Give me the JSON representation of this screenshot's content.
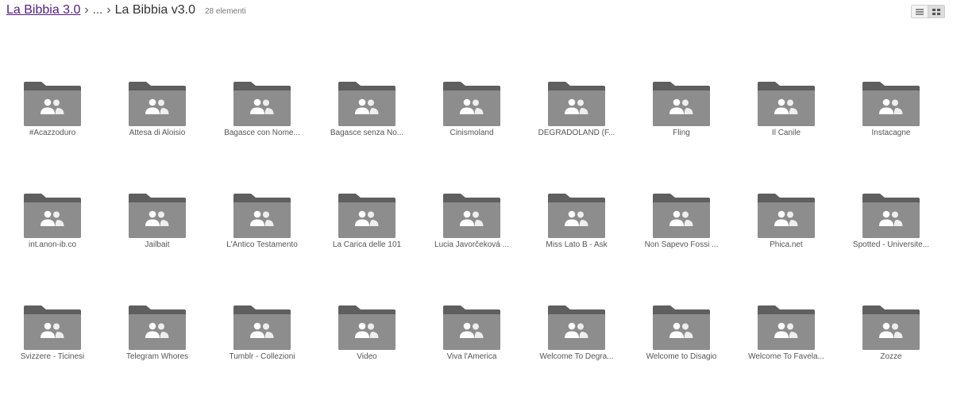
{
  "breadcrumb": {
    "root": "La Bibbia 3.0",
    "separator": "›",
    "ellipsis": "...",
    "current": "La Bibbia v3.0"
  },
  "item_count": "28 elementi",
  "view_toggle": {
    "list_icon": "list-view-icon",
    "grid_icon": "grid-view-icon",
    "active": "grid"
  },
  "colors": {
    "folder_body": "#8d8d8d",
    "folder_tab": "#5f5f5f",
    "folder_people": "#ffffff",
    "link": "#551a8b"
  },
  "folders": [
    {
      "name": "#Acazzoduro"
    },
    {
      "name": "Attesa di Aloisio"
    },
    {
      "name": "Bagasce con Nome..."
    },
    {
      "name": "Bagasce senza No..."
    },
    {
      "name": "Cinismoland"
    },
    {
      "name": "DEGRADOLAND (F..."
    },
    {
      "name": "Fling"
    },
    {
      "name": "Il Canile"
    },
    {
      "name": "Instacagne"
    },
    {
      "name": "int.anon-ib.co"
    },
    {
      "name": "Jailbait"
    },
    {
      "name": "L'Antico Testamento"
    },
    {
      "name": "La Carica delle 101"
    },
    {
      "name": "Lucia Javorčeková ..."
    },
    {
      "name": "Miss Lato B - Ask"
    },
    {
      "name": "Non Sapevo Fossi ..."
    },
    {
      "name": "Phica.net"
    },
    {
      "name": "Spotted - Universite..."
    },
    {
      "name": "Svizzere - Ticinesi"
    },
    {
      "name": "Telegram Whores"
    },
    {
      "name": "Tumblr - Collezioni"
    },
    {
      "name": "Video"
    },
    {
      "name": "Viva l'America"
    },
    {
      "name": "Welcome To Degra..."
    },
    {
      "name": "Welcome to Disagio"
    },
    {
      "name": "Welcome To Favela..."
    },
    {
      "name": "Zozze"
    }
  ]
}
